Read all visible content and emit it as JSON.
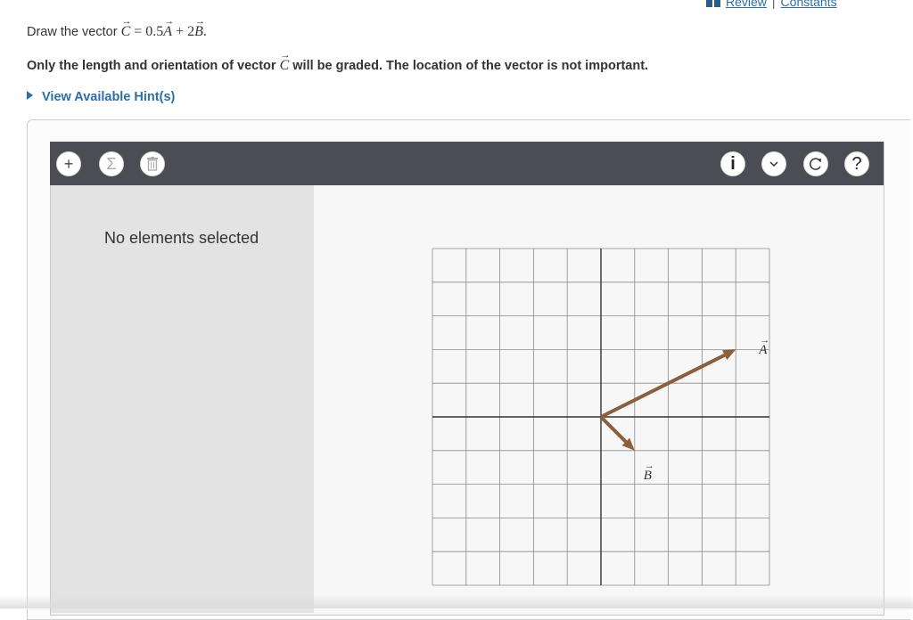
{
  "header": {
    "review_label": "Review",
    "separator": "|",
    "constants_label": "Constants",
    "book_icon": "book-icon"
  },
  "question": {
    "prefix": "Draw the vector ",
    "eq_C": "C",
    "eq_equals": " = 0.5",
    "eq_A": "A",
    "eq_plus": " + 2",
    "eq_B": "B",
    "eq_end": ".",
    "note_prefix": "Only the length and orientation of vector ",
    "note_C": "C",
    "note_suffix": " will be graded. The location of the vector is not important."
  },
  "hint": {
    "label": "View Available Hint(s)"
  },
  "toolbar": {
    "left_buttons": [
      {
        "icon": "plus-icon",
        "glyph": "+"
      },
      {
        "icon": "sigma-icon",
        "glyph": "Σ"
      },
      {
        "icon": "trash-icon",
        "glyph": ""
      }
    ],
    "right_buttons": [
      {
        "icon": "info-icon",
        "glyph": "i"
      },
      {
        "icon": "chevron-down-icon",
        "glyph": "⌄"
      },
      {
        "icon": "reset-icon",
        "glyph": "↻"
      },
      {
        "icon": "help-icon",
        "glyph": "?"
      }
    ]
  },
  "sidebar": {
    "status": "No elements selected"
  },
  "canvas": {
    "grid": {
      "columns": 10,
      "rows": 10,
      "x_range": [
        -5,
        5
      ],
      "y_range": [
        -5,
        5
      ]
    },
    "vectors": [
      {
        "name": "A",
        "label": "A",
        "tail": [
          0,
          0
        ],
        "head": [
          4,
          2
        ]
      },
      {
        "name": "B",
        "label": "B",
        "tail": [
          0,
          0
        ],
        "head": [
          1,
          -1
        ]
      }
    ],
    "vector_color": "#8b5e3c"
  },
  "colors": {
    "link": "#2b6ea8",
    "toolbar_bg": "#4b4c54",
    "sidebar_bg": "#e3e3e3"
  }
}
